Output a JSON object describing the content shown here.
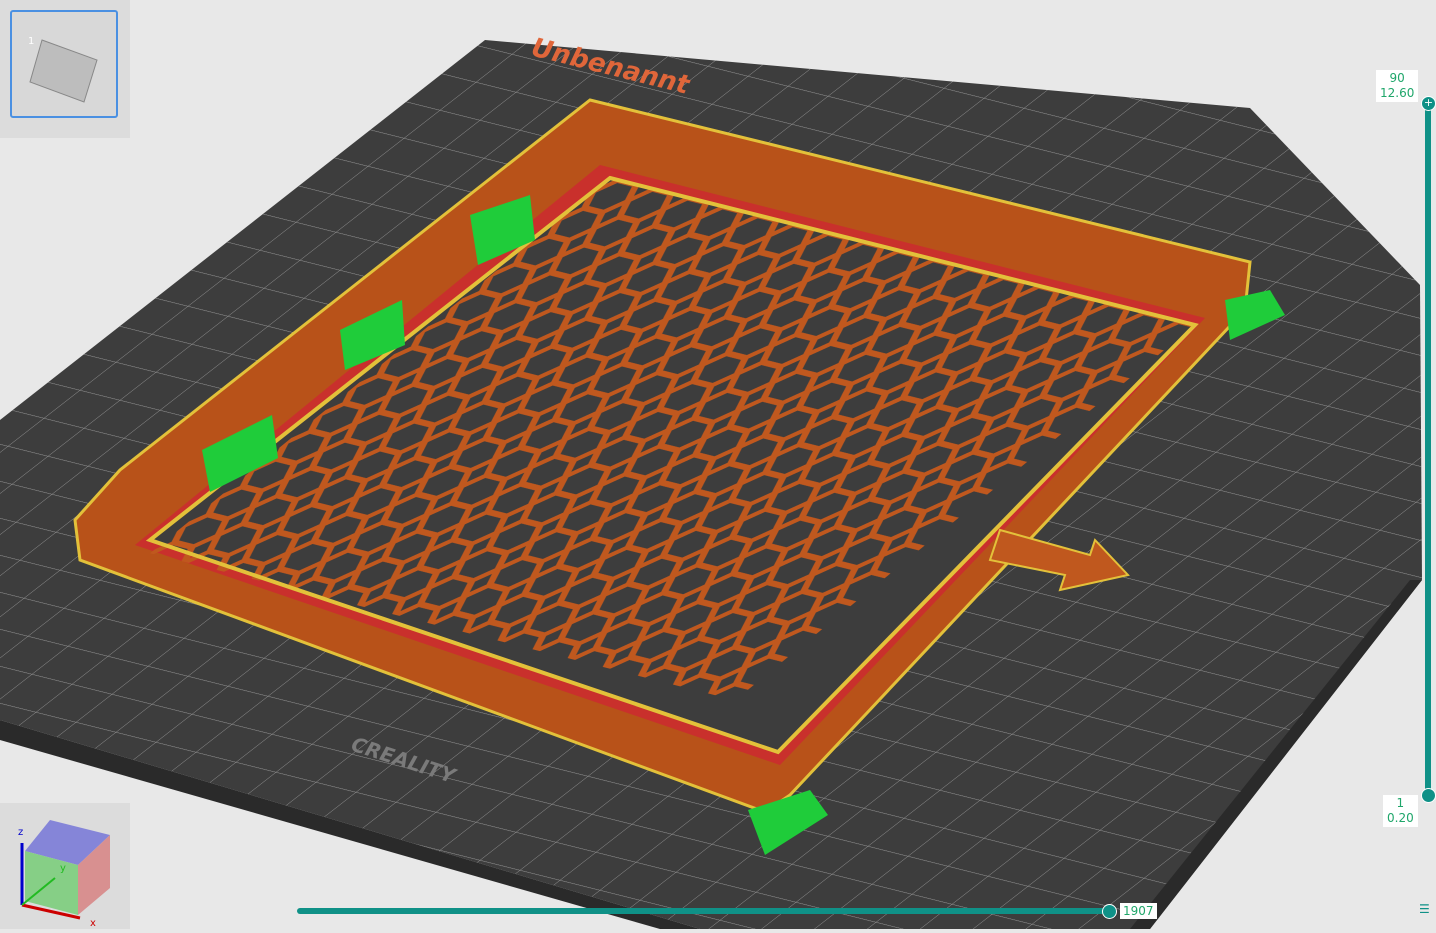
{
  "plate": {
    "name": "Unbenannt",
    "brand": "CREALITY"
  },
  "thumbnails": [
    {
      "index": "1"
    }
  ],
  "layer_slider": {
    "top": {
      "layer": "90",
      "height": "12.60"
    },
    "bottom": {
      "layer": "1",
      "height": "0.20"
    },
    "top_icon": "plus-icon",
    "layers_icon": "layers-icon"
  },
  "move_slider": {
    "value": "1907"
  },
  "view_cube": {
    "axes": [
      "z",
      "y",
      "x"
    ]
  },
  "colors": {
    "accent": "#0f9187",
    "label": "#1fa66a",
    "bed": "#3d3d3d",
    "wall": "#c0581e",
    "support": "#1fcc3a"
  }
}
